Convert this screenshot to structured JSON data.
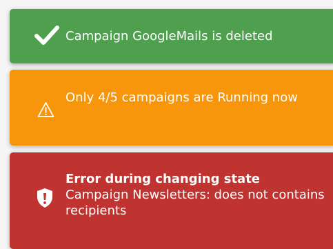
{
  "colors": {
    "success": "#4ea04f",
    "warning": "#f7950b",
    "error": "#bf3430",
    "text": "#ffffff"
  },
  "notifications": [
    {
      "type": "success",
      "icon": "checkmark-icon",
      "message": "Campaign GoogleMails is deleted"
    },
    {
      "type": "warning",
      "icon": "warning-triangle-icon",
      "message": "Only 4/5 campaigns are Running now"
    },
    {
      "type": "error",
      "icon": "shield-exclamation-icon",
      "title": "Error during changing state",
      "message": "Campaign Newsletters: does not contains recipients"
    }
  ]
}
